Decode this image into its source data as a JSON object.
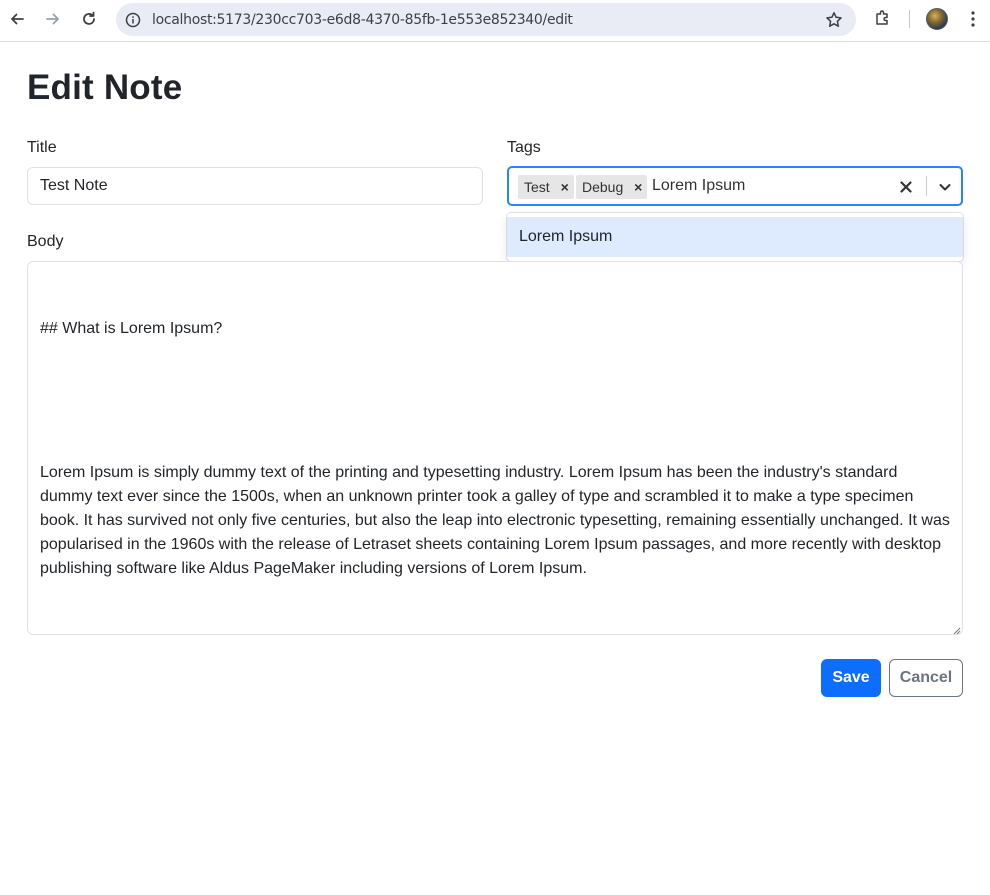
{
  "browser": {
    "url": "localhost:5173/230cc703-e6d8-4370-85fb-1e553e852340/edit",
    "icons": [
      "back-arrow-icon",
      "forward-arrow-icon",
      "reload-icon",
      "site-info-icon",
      "bookmark-star-icon",
      "extensions-icon",
      "profile-avatar",
      "kebab-menu-icon"
    ]
  },
  "page": {
    "title": "Edit Note"
  },
  "form": {
    "title_label": "Title",
    "title_value": "Test Note",
    "tags_label": "Tags",
    "tags": [
      {
        "label": "Test",
        "remove": "×"
      },
      {
        "label": "Debug",
        "remove": "×"
      }
    ],
    "tags_input_value": "Lorem Ipsum",
    "tags_options": [
      "Lorem Ipsum"
    ],
    "body_label": "Body",
    "body_heading_line": "## What is Lorem Ipsum?",
    "body_paragraph": "Lorem Ipsum is simply dummy text of the printing and typesetting industry. Lorem Ipsum has been the industry's standard dummy text ever since the 1500s, when an unknown printer took a galley of type and scrambled it to make a type specimen book. It has survived not only five centuries, but also the leap into electronic typesetting, remaining essentially unchanged. It was popularised in the 1960s with the release of Letraset sheets containing Lorem Ipsum passages, and more recently with desktop publishing software like Aldus PageMaker including versions of Lorem Ipsum.",
    "save_label": "Save",
    "cancel_label": "Cancel"
  },
  "colors": {
    "primary": "#0d6efd",
    "secondary": "#6c757d",
    "focus_border": "#2684ff",
    "option_highlight": "#deebff",
    "chip_bg": "#e6e6e6"
  }
}
